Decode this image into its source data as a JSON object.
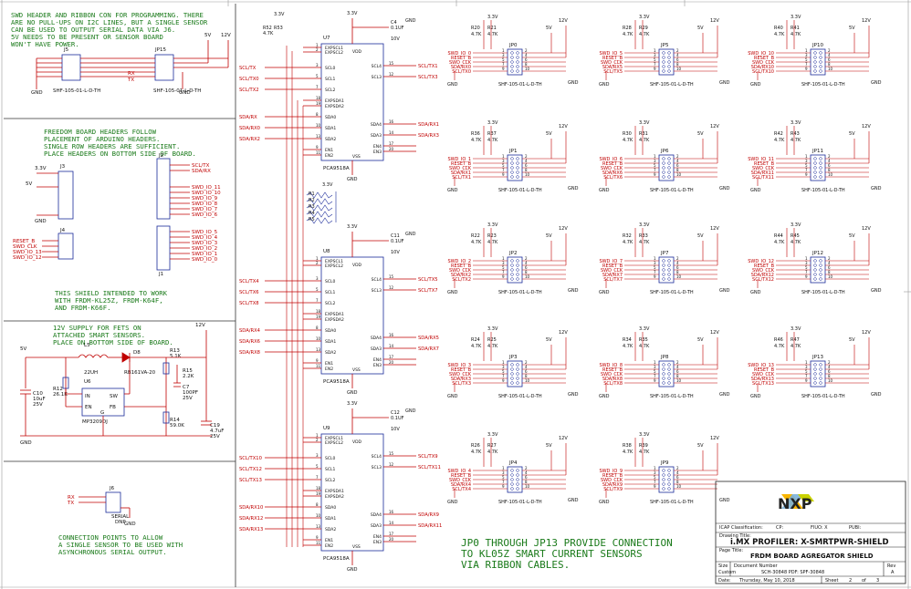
{
  "notes": {
    "swd": [
      "SWD HEADER AND RIBBON CON FOR PROGRAMMING. THERE",
      "ARE NO PULL-UPS ON I2C LINES, BUT A SINGLE SENSOR",
      "CAN BE USED TO OUTPUT SERIAL DATA VIA J6.",
      "5V NEEDS TO BE PRESENT OR SENSOR BOARD",
      "WON'T HAVE POWER."
    ],
    "freedom": [
      "FREEDOM BOARD HEADERS FOLLOW",
      "PLACEMENT OF ARDUINO HEADERS.",
      "SINGLE ROW HEADERS ARE SUFFICIENT.",
      "PLACE HEADERS ON BOTTOM SIDE OF BOARD."
    ],
    "shield": [
      "THIS SHIELD INTENDED TO WORK",
      "WITH FRDM-KL25Z, FRDM-K64F,",
      "AND FRDM-K66F."
    ],
    "supply": [
      "12V SUPPLY FOR FETS ON",
      "ATTACHED SMART SENSORS.",
      "PLACE ON BOTTOM SIDE OF BOARD."
    ],
    "serial": [
      "CONNECTION POINTS TO ALLOW",
      "A SINGLE SENSOR TO BE USED WITH",
      "ASYNCHRONOUS SERIAL OUTPUT."
    ],
    "bottom": [
      "JP0 THROUGH JP13 PROVIDE CONNECTION",
      "TO KL05Z SMART CURRENT SENSORS",
      "VIA RIBBON CABLES."
    ]
  },
  "left": {
    "j5_ref": "J5",
    "jp15_ref": "JP15",
    "j5_part": "SHF-105-01-L-D-TH",
    "jp15_part": "SHF-105-01-L-D-TH",
    "v5": "5V",
    "v12": "12V",
    "gnd": "GND",
    "v33": "3.3V",
    "j5_pins": [
      "1",
      "3",
      "5",
      "7",
      "9",
      "2",
      "4",
      "6",
      "8",
      "10"
    ],
    "rx": "RX",
    "tx": "TX",
    "rx_tx_nets": [
      "RX",
      "TX"
    ],
    "j3_ref": "J3",
    "j4_ref": "J4",
    "j2_ref": "J2",
    "j1_ref": "J1",
    "j4_nets": [
      "RESET_B",
      "SWD_CLK",
      "SWD_IO_13",
      "SWD_IO_12"
    ],
    "j2_nets": [
      "SCL/TX",
      "SDA/RX",
      "",
      "",
      "SWD_IO_11",
      "SWD_IO_10",
      "SWD_IO_9",
      "SWD_IO_8",
      "SWD_IO_7",
      "SWD_IO_6"
    ],
    "j1_nets": [
      "SWD_IO_5",
      "SWD_IO_4",
      "SWD_IO_3",
      "SWD_IO_2",
      "SWD_IO_1",
      "SWD_IO_0"
    ],
    "j2_pins": [
      "10",
      "9",
      "8",
      "7",
      "6",
      "5",
      "4",
      "3",
      "2",
      "1"
    ],
    "j1_pins": [
      "8",
      "7",
      "6",
      "5",
      "4",
      "3",
      "2",
      "1"
    ],
    "rn_labels": [
      "R1",
      "R2",
      "R3",
      "R4",
      "R5",
      "R6"
    ],
    "l5": "L5",
    "l5_val": "22UH",
    "d8": "D8",
    "d8_part": "RB161VA-20",
    "u6": "U6",
    "u6_part": "MP3209DJ",
    "u6_pins": [
      "IN",
      "SW",
      "EN",
      "FB",
      "G"
    ],
    "r12": "R12",
    "r12_val": "26.1K",
    "r13": "R13",
    "r13_val": "5.1K",
    "r14": "R14",
    "r14_val": "59.0K",
    "r15": "R15",
    "r15_val": "2.2K",
    "c10": "C10",
    "c10_val": "10uF",
    "c10_v": "25V",
    "c7": "C7",
    "c7_val": "100PF",
    "c7_v": "25V",
    "c19": "C19",
    "c19_val": "4.7uF",
    "c19_v": "25V",
    "j6": "J6",
    "j6_part": "SERIAL",
    "j6_dnp": "DNP"
  },
  "muxes": [
    {
      "ref": "U7",
      "part": "PCA9518A",
      "r1": "R52",
      "r2": "R53",
      "rv": "4.7K",
      "c": "C4",
      "cv": "0.1UF",
      "cvolt": "10V",
      "scl_in": [
        "SCL/TX",
        "SCL/TX0",
        "SCL/TX2"
      ],
      "sda_in": [
        "SDA/RX",
        "SDA/RX0",
        "SDA/RX2"
      ],
      "scl_out": [
        "SCL/TX1",
        "SCL/TX3"
      ],
      "sda_out": [
        "SDA/RX1",
        "SDA/RX3"
      ]
    },
    {
      "ref": "U8",
      "part": "PCA9518A",
      "r1": "",
      "r2": "",
      "rv": "",
      "c": "C11",
      "cv": "0.1UF",
      "cvolt": "10V",
      "scl_in": [
        "SCL/TX4",
        "SCL/TX6",
        "SCL/TX8"
      ],
      "sda_in": [
        "SDA/RX4",
        "SDA/RX6",
        "SDA/RX8"
      ],
      "scl_out": [
        "SCL/TX5",
        "SCL/TX7"
      ],
      "sda_out": [
        "SDA/RX5",
        "SDA/RX7"
      ]
    },
    {
      "ref": "U9",
      "part": "PCA9518A",
      "r1": "",
      "r2": "",
      "rv": "",
      "c": "C12",
      "cv": "0.1UF",
      "cvolt": "10V",
      "scl_in": [
        "SCL/TX10",
        "SCL/TX12",
        "SCL/TX13"
      ],
      "sda_in": [
        "SDA/RX10",
        "SDA/RX12",
        "SDA/RX13"
      ],
      "scl_out": [
        "SCL/TX9",
        "SCL/TX11"
      ],
      "sda_out": [
        "SDA/RX9",
        "SDA/RX11"
      ]
    }
  ],
  "mux_pins_left": [
    "EXPSCL1",
    "EXPSCL2",
    "SCL0",
    "SCL1",
    "SCL2",
    "EXPSDA1",
    "EXPSDA2",
    "SDA0",
    "SDA1",
    "SDA2",
    "EN1",
    "EN2"
  ],
  "mux_pins_left_num": [
    "1",
    "2",
    "3",
    "5",
    "7",
    "18",
    "19",
    "8",
    "10",
    "13",
    "9",
    "11"
  ],
  "mux_pins_right": [
    "SCL4",
    "SCL3",
    "SDA4",
    "SDA3",
    "EN4",
    "EN3"
  ],
  "mux_pins_right_num": [
    "15",
    "12",
    "16",
    "14",
    "17",
    "20"
  ],
  "mux_vdd": "VDD",
  "mux_vss": "VSS",
  "mux_vdd_num": "20",
  "mux_vss_num": "8",
  "mux_resistors_u8": [
    "R53",
    "R54"
  ],
  "sensor_pins_left": [
    "1",
    "3",
    "5",
    "7",
    "9"
  ],
  "sensor_pins_right": [
    "2",
    "4",
    "6",
    "8",
    "10"
  ],
  "sensor_rv": "4.7K",
  "sensor_part": "SHF-105-01-L-D-TH",
  "sensors": [
    {
      "ref": "JP0",
      "ra": "R20",
      "rb": "R21",
      "nets": [
        "SWD_IO_0",
        "RESET_B",
        "SWD_CLK",
        "SDA/RX0",
        "SCL/TX0"
      ]
    },
    {
      "ref": "JP5",
      "ra": "R28",
      "rb": "R29",
      "nets": [
        "SWD_IO_5",
        "RESET_B",
        "SWD_CLK",
        "SDA/RX5",
        "SCL/TX5"
      ]
    },
    {
      "ref": "JP10",
      "ra": "R40",
      "rb": "R41",
      "nets": [
        "SWD_IO_10",
        "RESET_B",
        "SWD_CLK",
        "SDA/RX10",
        "SCL/TX10"
      ]
    },
    {
      "ref": "JP1",
      "ra": "R36",
      "rb": "R37",
      "nets": [
        "SWD_IO_1",
        "RESET_B",
        "SWD_CLK",
        "SDA/RX1",
        "SCL/TX1"
      ]
    },
    {
      "ref": "JP6",
      "ra": "R30",
      "rb": "R31",
      "nets": [
        "SWD_IO_6",
        "RESET_B",
        "SWD_CLK",
        "SDA/RX6",
        "SCL/TX6"
      ]
    },
    {
      "ref": "JP11",
      "ra": "R42",
      "rb": "R43",
      "nets": [
        "SWD_IO_11",
        "RESET_B",
        "SWD_CLK",
        "SDA/RX11",
        "SCL/TX11"
      ]
    },
    {
      "ref": "JP2",
      "ra": "R22",
      "rb": "R23",
      "nets": [
        "SWD_IO_2",
        "RESET_B",
        "SWD_CLK",
        "SDA/RX2",
        "SCL/TX2"
      ]
    },
    {
      "ref": "JP7",
      "ra": "R32",
      "rb": "R33",
      "nets": [
        "SWD_IO_7",
        "RESET_B",
        "SWD_CLK",
        "SDA/RX7",
        "SCL/TX7"
      ]
    },
    {
      "ref": "JP12",
      "ra": "R44",
      "rb": "R45",
      "nets": [
        "SWD_IO_12",
        "RESET_B",
        "SWD_CLK",
        "SDA/RX12",
        "SCL/TX12"
      ]
    },
    {
      "ref": "JP3",
      "ra": "R24",
      "rb": "R25",
      "nets": [
        "SWD_IO_3",
        "RESET_B",
        "SWD_CLK",
        "SDA/RX3",
        "SCL/TX3"
      ]
    },
    {
      "ref": "JP8",
      "ra": "R34",
      "rb": "R35",
      "nets": [
        "SWD_IO_8",
        "RESET_B",
        "SWD_CLK",
        "SDA/RX8",
        "SCL/TX8"
      ]
    },
    {
      "ref": "JP13",
      "ra": "R46",
      "rb": "R47",
      "nets": [
        "SWD_IO_13",
        "RESET_B",
        "SWD_CLK",
        "SDA/RX13",
        "SCL/TX13"
      ]
    },
    {
      "ref": "JP4",
      "ra": "R26",
      "rb": "R27",
      "nets": [
        "SWD_IO_4",
        "RESET_B",
        "SWD_CLK",
        "SDA/RX4",
        "SCL/TX4"
      ]
    },
    {
      "ref": "JP9",
      "ra": "R38",
      "rb": "R39",
      "nets": [
        "SWD_IO_9",
        "RESET_B",
        "SWD_CLK",
        "SDA/RX9",
        "SCL/TX9"
      ]
    }
  ],
  "title_block": {
    "icap_label": "ICAP Classification:",
    "cp": "CP:",
    "fiuo": "FIUO: X",
    "pubi": "PUBI:",
    "drawing_title_label": "Drawing Title:",
    "drawing_title": "i.MX PROFILER:  X-SMRTPWR-SHIELD",
    "page_title_label": "Page Title:",
    "page_title": "FRDM BOARD AGREGATOR SHIELD",
    "size_label": "Size",
    "size_val": "Custom",
    "docnum_label": "Document Number",
    "docnum": "SCH-30848 PDF: SPF-30848",
    "rev_label": "Rev",
    "rev": "A",
    "date_label": "Date:",
    "date": "Thursday, May 10, 2018",
    "sheet_label": "Sheet",
    "sheet": "2",
    "of_label": "of",
    "of": "3"
  }
}
